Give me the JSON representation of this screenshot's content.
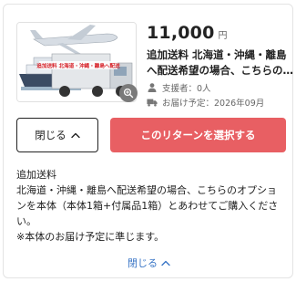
{
  "reward": {
    "price": "11,000",
    "currency": "円",
    "title_lines": [
      "追加送料 北海道・沖縄・離島",
      "へ配送希望の場合、こちらの…"
    ],
    "supporters": "支援者：0人",
    "delivery": "お届け予定：2026年09月",
    "thumbnail_caption": "追加送料 北海道・沖縄・離島へ配送",
    "icons": {
      "zoom": "zoom-in-icon",
      "supporters": "person-icon",
      "delivery": "truck-icon",
      "collapse": "chevron-up-icon"
    }
  },
  "buttons": {
    "close_label": "閉じる",
    "select_label": "このリターンを選択する"
  },
  "description": {
    "lines": [
      "追加送料",
      "北海道・沖縄・離島へ配送希望の場合、こちらのオプショ",
      "ンを本体（本体1箱+付属品1箱）とあわせてご購入くださ",
      "い。",
      "※本体のお届け予定に準じます。"
    ]
  },
  "footer": {
    "collapse_label": "閉じる"
  },
  "colors": {
    "accent": "#e85f63",
    "link": "#3a76c6",
    "text": "#222222",
    "muted": "#666666"
  }
}
